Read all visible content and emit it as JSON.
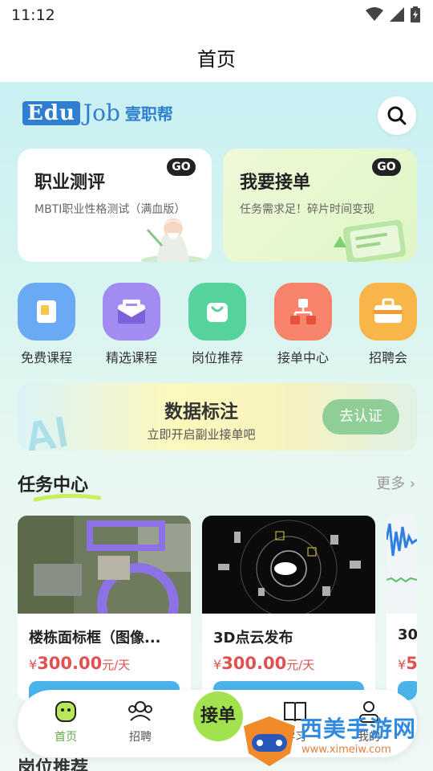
{
  "status": {
    "time": "11:12"
  },
  "header": {
    "title": "首页"
  },
  "logo": {
    "edu": "Edu",
    "job": "Job",
    "brand": "壹职帮"
  },
  "cards": [
    {
      "title": "职业测评",
      "subtitle": "MBTI职业性格测试（满血版）",
      "badge": "GO"
    },
    {
      "title": "我要接单",
      "subtitle": "任务需求足！碎片时间变现",
      "badge": "GO"
    }
  ],
  "menu": [
    {
      "label": "免费课程",
      "color": "#6aaaf4"
    },
    {
      "label": "精选课程",
      "color": "#a28bf1"
    },
    {
      "label": "岗位推荐",
      "color": "#55d39c"
    },
    {
      "label": "接单中心",
      "color": "#f7836a"
    },
    {
      "label": "招聘会",
      "color": "#f8b64a"
    }
  ],
  "banner": {
    "title": "数据标注",
    "subtitle": "立即开启副业接单吧",
    "button": "去认证"
  },
  "task_section": {
    "title": "任务中心",
    "more": "更多"
  },
  "tasks": [
    {
      "name": "楼栋面标框（图像...",
      "currency": "¥",
      "amount": "300.00",
      "unit": "元/天"
    },
    {
      "name": "3D点云发布",
      "currency": "¥",
      "amount": "300.00",
      "unit": "元/天"
    },
    {
      "name": "30",
      "currency": "¥",
      "amount": "5",
      "unit": ""
    }
  ],
  "next_section": {
    "title": "岗位推荐"
  },
  "tabbar": {
    "home": "首页",
    "recruit": "招聘",
    "center": "接单",
    "study": "学习",
    "mine": "我的"
  },
  "watermark": {
    "text": "西美手游网",
    "url": "www.ximeiw.com"
  }
}
